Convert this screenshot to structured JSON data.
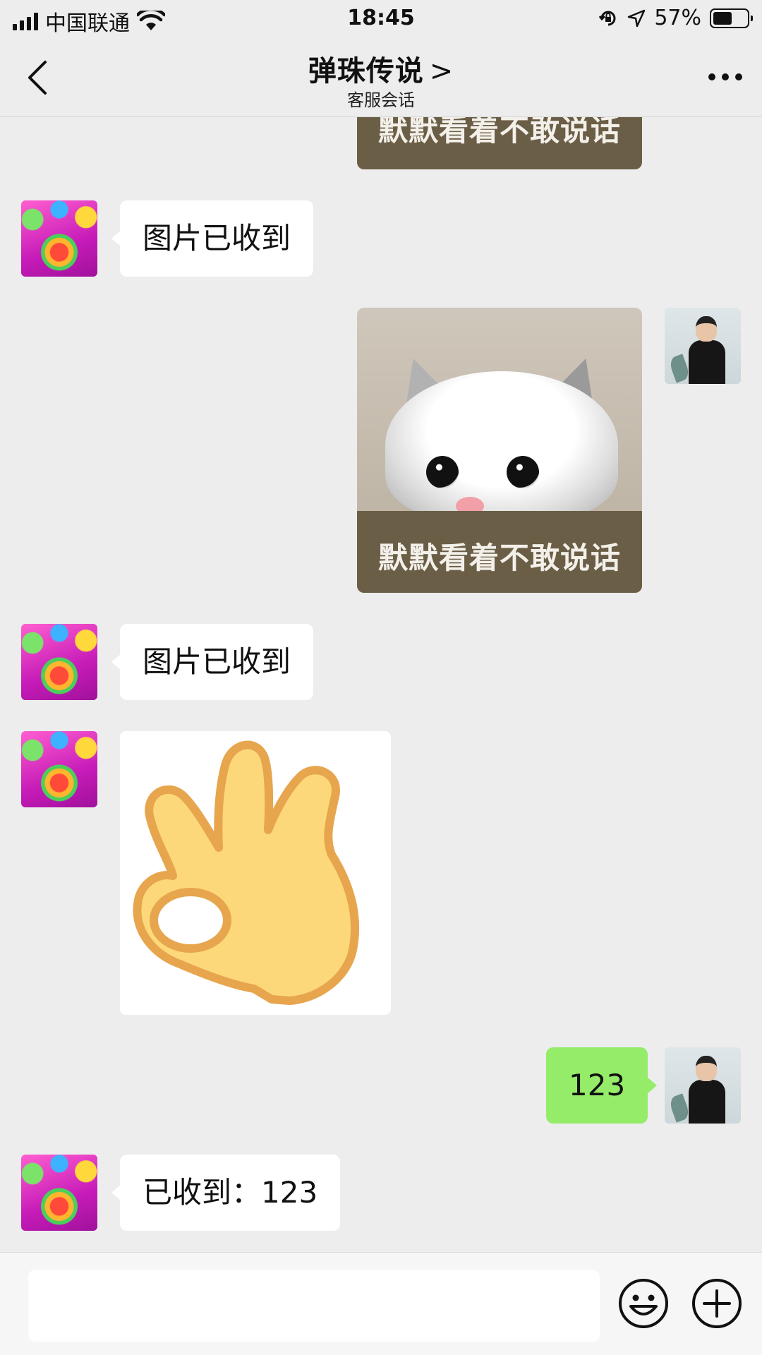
{
  "status_bar": {
    "carrier": "中国联通",
    "time": "18:45",
    "battery": "57%",
    "battery_level": 0.57,
    "icons": [
      "signal-icon",
      "wifi-icon",
      "orientation-lock-icon",
      "location-icon",
      "battery-icon"
    ]
  },
  "nav": {
    "title": "弹珠传说",
    "title_chevron": ">",
    "subtitle": "客服会话",
    "back_icon": "chevron-left-icon",
    "more_icon": "more-dots-icon"
  },
  "messages": [
    {
      "from": "user",
      "type": "sticker",
      "caption": "默默看着不敢说话"
    },
    {
      "from": "bot",
      "type": "text",
      "text": "图片已收到"
    },
    {
      "from": "user",
      "type": "sticker",
      "caption": "默默看着不敢说话"
    },
    {
      "from": "bot",
      "type": "text",
      "text": "图片已收到"
    },
    {
      "from": "bot",
      "type": "sticker",
      "caption": ""
    },
    {
      "from": "user",
      "type": "text",
      "text": "123"
    },
    {
      "from": "bot",
      "type": "text",
      "text": "已收到：123"
    }
  ],
  "input_bar": {
    "placeholder": "",
    "emoji_icon": "emoji-icon",
    "plus_icon": "plus-circle-icon"
  },
  "colors": {
    "background": "#ededed",
    "sent_bubble": "#95ec69",
    "received_bubble": "#ffffff"
  }
}
